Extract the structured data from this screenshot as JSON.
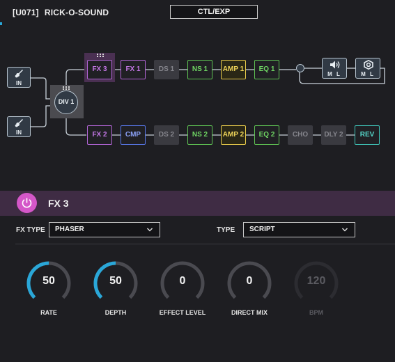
{
  "header": {
    "patch_number": "[U071]",
    "patch_name": "RICK-O-SOUND",
    "ctl_button": "CTL/EXP"
  },
  "signal_chain": {
    "inputs": [
      {
        "label": "IN",
        "icon": "guitar-icon"
      },
      {
        "label": "IN",
        "icon": "guitar-icon"
      }
    ],
    "divider": {
      "label": "DIV 1"
    },
    "row_a": [
      {
        "label": "FX 3",
        "color": "#b265d6",
        "state": "selected"
      },
      {
        "label": "FX 1",
        "color": "#b265d6",
        "state": "on"
      },
      {
        "label": "DS 1",
        "color": "#3a3a40",
        "state": "off"
      },
      {
        "label": "NS 1",
        "color": "#5fc353",
        "state": "on"
      },
      {
        "label": "AMP 1",
        "color": "#e9cc4b",
        "state": "on"
      },
      {
        "label": "EQ 1",
        "color": "#5fc353",
        "state": "on"
      }
    ],
    "row_b": [
      {
        "label": "FX 2",
        "color": "#b265d6",
        "state": "on"
      },
      {
        "label": "CMP",
        "color": "#5877e8",
        "state": "on"
      },
      {
        "label": "DS 2",
        "color": "#3a3a40",
        "state": "off"
      },
      {
        "label": "NS 2",
        "color": "#5fc353",
        "state": "on"
      },
      {
        "label": "AMP 2",
        "color": "#e9cc4b",
        "state": "on"
      },
      {
        "label": "EQ 2",
        "color": "#5fc353",
        "state": "on"
      },
      {
        "label": "CHO",
        "color": "#3a3a40",
        "state": "off"
      },
      {
        "label": "DLY 2",
        "color": "#3a3a40",
        "state": "off"
      },
      {
        "label": "REV",
        "color": "#3fc3b7",
        "state": "on"
      }
    ],
    "outputs": [
      {
        "label": "M L",
        "icon": "speaker-icon"
      },
      {
        "label": "M L",
        "icon": "hex-nut-icon"
      }
    ]
  },
  "fx_panel": {
    "title": "FX 3",
    "power_on": true,
    "accent": "#d457c8",
    "fx_type_label": "FX TYPE",
    "fx_type_value": "PHASER",
    "type_label": "TYPE",
    "type_value": "SCRIPT",
    "knobs": [
      {
        "label": "RATE",
        "value": "50",
        "fraction": 0.5,
        "active": true
      },
      {
        "label": "DEPTH",
        "value": "50",
        "fraction": 0.5,
        "active": true
      },
      {
        "label": "EFFECT LEVEL",
        "value": "0",
        "fraction": 0.0,
        "active": true
      },
      {
        "label": "DIRECT MIX",
        "value": "0",
        "fraction": 0.0,
        "active": true
      },
      {
        "label": "BPM",
        "value": "120",
        "fraction": 0.0,
        "active": false
      }
    ]
  },
  "colors": {
    "background": "#1e1e22",
    "knob_accent": "#2aa7d8",
    "knob_track": "#4a4a50"
  }
}
